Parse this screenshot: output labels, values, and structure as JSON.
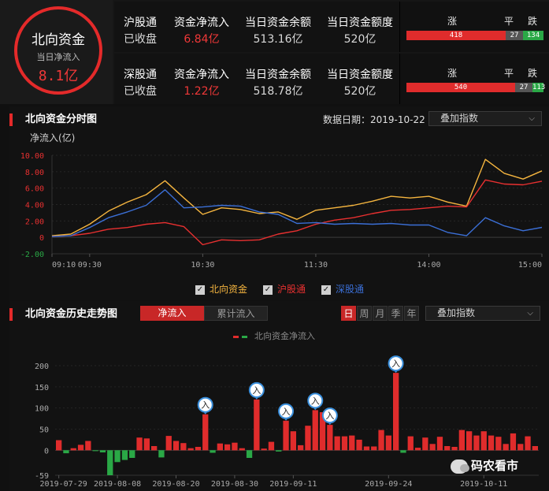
{
  "summary": {
    "title": "北向资金",
    "subtitle": "当日净流入",
    "net_inflow": "8.1亿"
  },
  "markets": [
    {
      "name": "沪股通",
      "status": "已收盘",
      "h1": "资金净流入",
      "v1": "6.84亿",
      "h2": "当日资金余额",
      "v2": "513.16亿",
      "h3": "当日资金额度",
      "v3": "520亿",
      "up_label": "涨",
      "flat_label": "平",
      "down_label": "跌",
      "up": 418,
      "flat": 27,
      "down": 134
    },
    {
      "name": "深股通",
      "status": "已收盘",
      "h1": "资金净流入",
      "v1": "1.22亿",
      "h2": "当日资金余额",
      "v2": "518.78亿",
      "h3": "当日资金额度",
      "v3": "520亿",
      "up_label": "涨",
      "flat_label": "平",
      "down_label": "跌",
      "up": 540,
      "flat": 27,
      "down": 113
    }
  ],
  "intraday": {
    "title": "北向资金分时图",
    "date_label": "数据日期：2019-10-22",
    "overlay_label": "叠加指数",
    "legend": [
      "北向资金",
      "沪股通",
      "深股通"
    ]
  },
  "history": {
    "title": "北向资金历史走势图",
    "tab_net": "净流入",
    "tab_cum": "累计流入",
    "periods": [
      "日",
      "周",
      "月",
      "季",
      "年"
    ],
    "overlay_label": "叠加指数",
    "legend": "北向资金净流入",
    "marker_char": "入"
  },
  "watermark": "码农看市",
  "colors": {
    "north": "#f5b53f",
    "sh": "#e83030",
    "sz": "#3b6fd6",
    "up": "#e02c2c",
    "down": "#2aa846"
  },
  "chart_data": [
    {
      "type": "line",
      "ylabel": "净流入(亿)",
      "ylim": [
        -2,
        10
      ],
      "yticks": [
        -2.0,
        0,
        2.0,
        4.0,
        6.0,
        8.0,
        10.0
      ],
      "ytick_labels": [
        "-2.00",
        "0",
        "2.00",
        "4.00",
        "6.00",
        "8.00",
        "10.00"
      ],
      "xticks": [
        "09:10",
        "09:30",
        "10:30",
        "11:30",
        "14:00",
        "15:00"
      ],
      "x": [
        "09:10",
        "09:20",
        "09:30",
        "09:40",
        "09:50",
        "10:00",
        "10:10",
        "10:20",
        "10:30",
        "10:40",
        "10:50",
        "11:00",
        "11:10",
        "11:20",
        "11:30",
        "13:10",
        "13:20",
        "13:30",
        "13:40",
        "13:50",
        "14:00",
        "14:10",
        "14:20",
        "14:30",
        "14:40",
        "14:50",
        "15:00"
      ],
      "series": [
        {
          "name": "北向资金",
          "values": [
            0.2,
            0.4,
            1.6,
            3.2,
            4.3,
            5.2,
            6.9,
            4.8,
            2.8,
            3.6,
            3.4,
            2.9,
            3.1,
            2.2,
            3.3,
            3.6,
            3.9,
            4.4,
            5.0,
            4.8,
            5.0,
            4.3,
            3.8,
            9.5,
            7.8,
            7.1,
            8.1
          ]
        },
        {
          "name": "沪股通",
          "values": [
            0.1,
            0.2,
            0.5,
            1.0,
            1.2,
            1.6,
            1.8,
            1.3,
            -0.9,
            -0.3,
            -0.4,
            -0.3,
            0.4,
            0.8,
            1.6,
            2.1,
            2.4,
            2.9,
            3.3,
            3.4,
            3.6,
            3.8,
            3.7,
            7.0,
            6.5,
            6.4,
            6.84
          ]
        },
        {
          "name": "深股通",
          "values": [
            0.1,
            0.2,
            1.2,
            2.4,
            3.1,
            3.9,
            5.8,
            3.6,
            3.7,
            3.9,
            3.8,
            3.1,
            2.8,
            1.7,
            1.8,
            1.6,
            1.7,
            1.6,
            1.7,
            1.5,
            1.5,
            0.6,
            0.2,
            2.4,
            1.4,
            0.8,
            1.22
          ]
        }
      ]
    },
    {
      "type": "bar",
      "ylim": [
        -59,
        200
      ],
      "yticks": [
        -59,
        0,
        50,
        100,
        150,
        200
      ],
      "xticks": [
        "2019-07-29",
        "2019-08-08",
        "2019-08-20",
        "2019-08-30",
        "2019-09-11",
        "2019-09-24",
        "2019-10-11"
      ],
      "series": [
        {
          "name": "北向资金净流入",
          "values": [
            24,
            -7,
            5,
            13,
            22,
            -2,
            -5,
            -59,
            -28,
            -23,
            -18,
            30,
            28,
            10,
            -17,
            34,
            22,
            17,
            5,
            8,
            85,
            -6,
            16,
            14,
            18,
            5,
            -18,
            120,
            4,
            20,
            -3,
            70,
            45,
            12,
            58,
            95,
            90,
            60,
            33,
            33,
            35,
            25,
            9,
            9,
            48,
            35,
            183,
            -6,
            33,
            6,
            30,
            15,
            32,
            10,
            8,
            48,
            45,
            35,
            45,
            35,
            32,
            15,
            40,
            15,
            33,
            10
          ]
        }
      ],
      "markers_at": [
        20,
        27,
        31,
        35,
        37,
        46
      ]
    }
  ]
}
